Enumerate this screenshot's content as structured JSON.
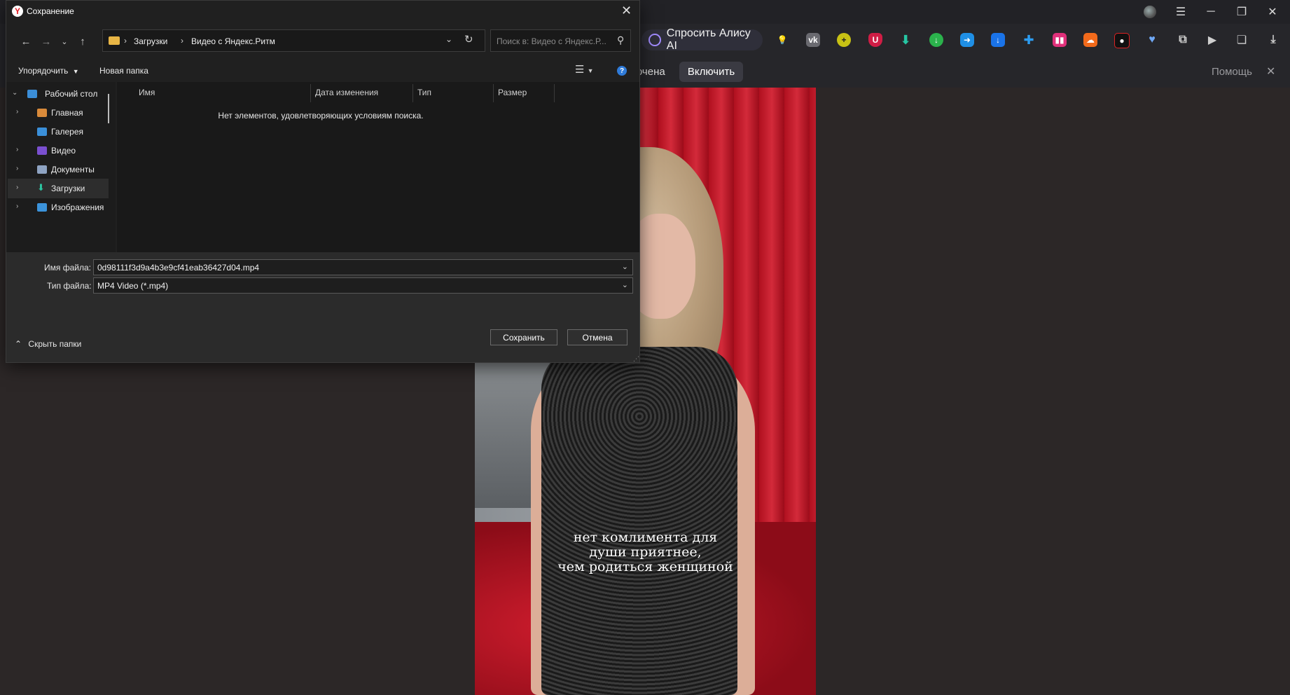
{
  "colors": {
    "dialog_bg": "#202020",
    "bottom_bg": "#2b2b2b",
    "accent": "#2f7bd9",
    "alice_ring": "#a28cff",
    "page_bg": "#2c2727"
  },
  "browser": {
    "alice_label": "Спросить Алису AI",
    "infobar_text": "ючена",
    "enable_label": "Включить",
    "help_label": "Помощь",
    "extension_icons": [
      "lightbulb-icon",
      "vk-icon",
      "plus-coin-icon",
      "ublock-icon",
      "download-icon",
      "green-download-icon",
      "arrow-right-icon",
      "blue-download-icon",
      "puzzle-icon",
      "soundbars-icon",
      "soundcloud-icon",
      "screen-recorder-icon",
      "heart-plus-icon",
      "extensions-icon",
      "video-icon",
      "collections-icon",
      "downloads-tray-icon"
    ]
  },
  "video": {
    "caption_lines": [
      "нет комлимента для",
      "души приятнее,",
      "чем родиться женщиной"
    ]
  },
  "dialog": {
    "title": "Сохранение",
    "breadcrumbs": [
      "Загрузки",
      "Видео с Яндекс.Ритм"
    ],
    "search_placeholder": "Поиск в: Видео с Яндекс.Р...",
    "organize_label": "Упорядочить",
    "new_folder_label": "Новая папка",
    "nav_items": [
      {
        "label": "Рабочий стол",
        "icon": "desktop-icon",
        "expanded": true
      },
      {
        "label": "Главная",
        "icon": "home-icon"
      },
      {
        "label": "Галерея",
        "icon": "gallery-icon"
      },
      {
        "label": "Видео",
        "icon": "video-folder-icon"
      },
      {
        "label": "Документы",
        "icon": "documents-icon"
      },
      {
        "label": "Загрузки",
        "icon": "downloads-icon",
        "selected": true
      },
      {
        "label": "Изображения",
        "icon": "images-icon"
      }
    ],
    "columns": [
      "Имя",
      "Дата изменения",
      "Тип",
      "Размер"
    ],
    "empty_message": "Нет элементов, удовлетворяющих условиям поиска.",
    "filename_label": "Имя файла:",
    "filename_value": "0d98111f3d9a4b3e9cf41eab36427d04.mp4",
    "filetype_label": "Тип файла:",
    "filetype_value": "MP4 Video (*.mp4)",
    "hide_folders_label": "Скрыть папки",
    "save_label": "Сохранить",
    "cancel_label": "Отмена"
  }
}
